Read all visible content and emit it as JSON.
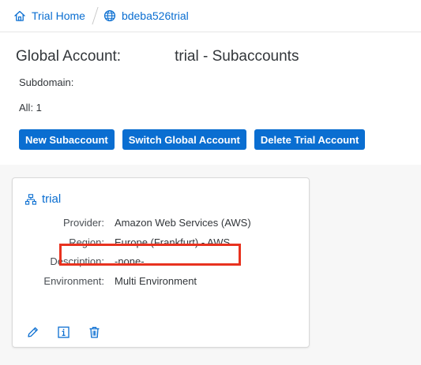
{
  "breadcrumb": {
    "home_label": "Trial Home",
    "account_label": "bdeba526trial",
    "home_icon": "home-icon",
    "account_icon": "globe-icon"
  },
  "header": {
    "title_prefix": "Global Account:",
    "title_suffix": "trial - Subaccounts",
    "subdomain_label": "Subdomain:",
    "count_label": "All: 1"
  },
  "actions": {
    "new_subaccount": "New Subaccount",
    "switch_global_account": "Switch Global Account",
    "delete_trial_account": "Delete Trial Account"
  },
  "tile": {
    "name": "trial",
    "icon": "hierarchy-icon",
    "properties": [
      {
        "label": "Provider:",
        "value": "Amazon Web Services (AWS)"
      },
      {
        "label": "Region:",
        "value": "Europe (Frankfurt) - AWS"
      },
      {
        "label": "Description:",
        "value": "-none-"
      },
      {
        "label": "Environment:",
        "value": "Multi Environment"
      }
    ],
    "footer_icons": [
      "edit-icon",
      "info-icon",
      "delete-icon"
    ]
  },
  "colors": {
    "accent": "#0a6ed1",
    "highlight": "#e8321f",
    "background": "#f7f7f7"
  }
}
